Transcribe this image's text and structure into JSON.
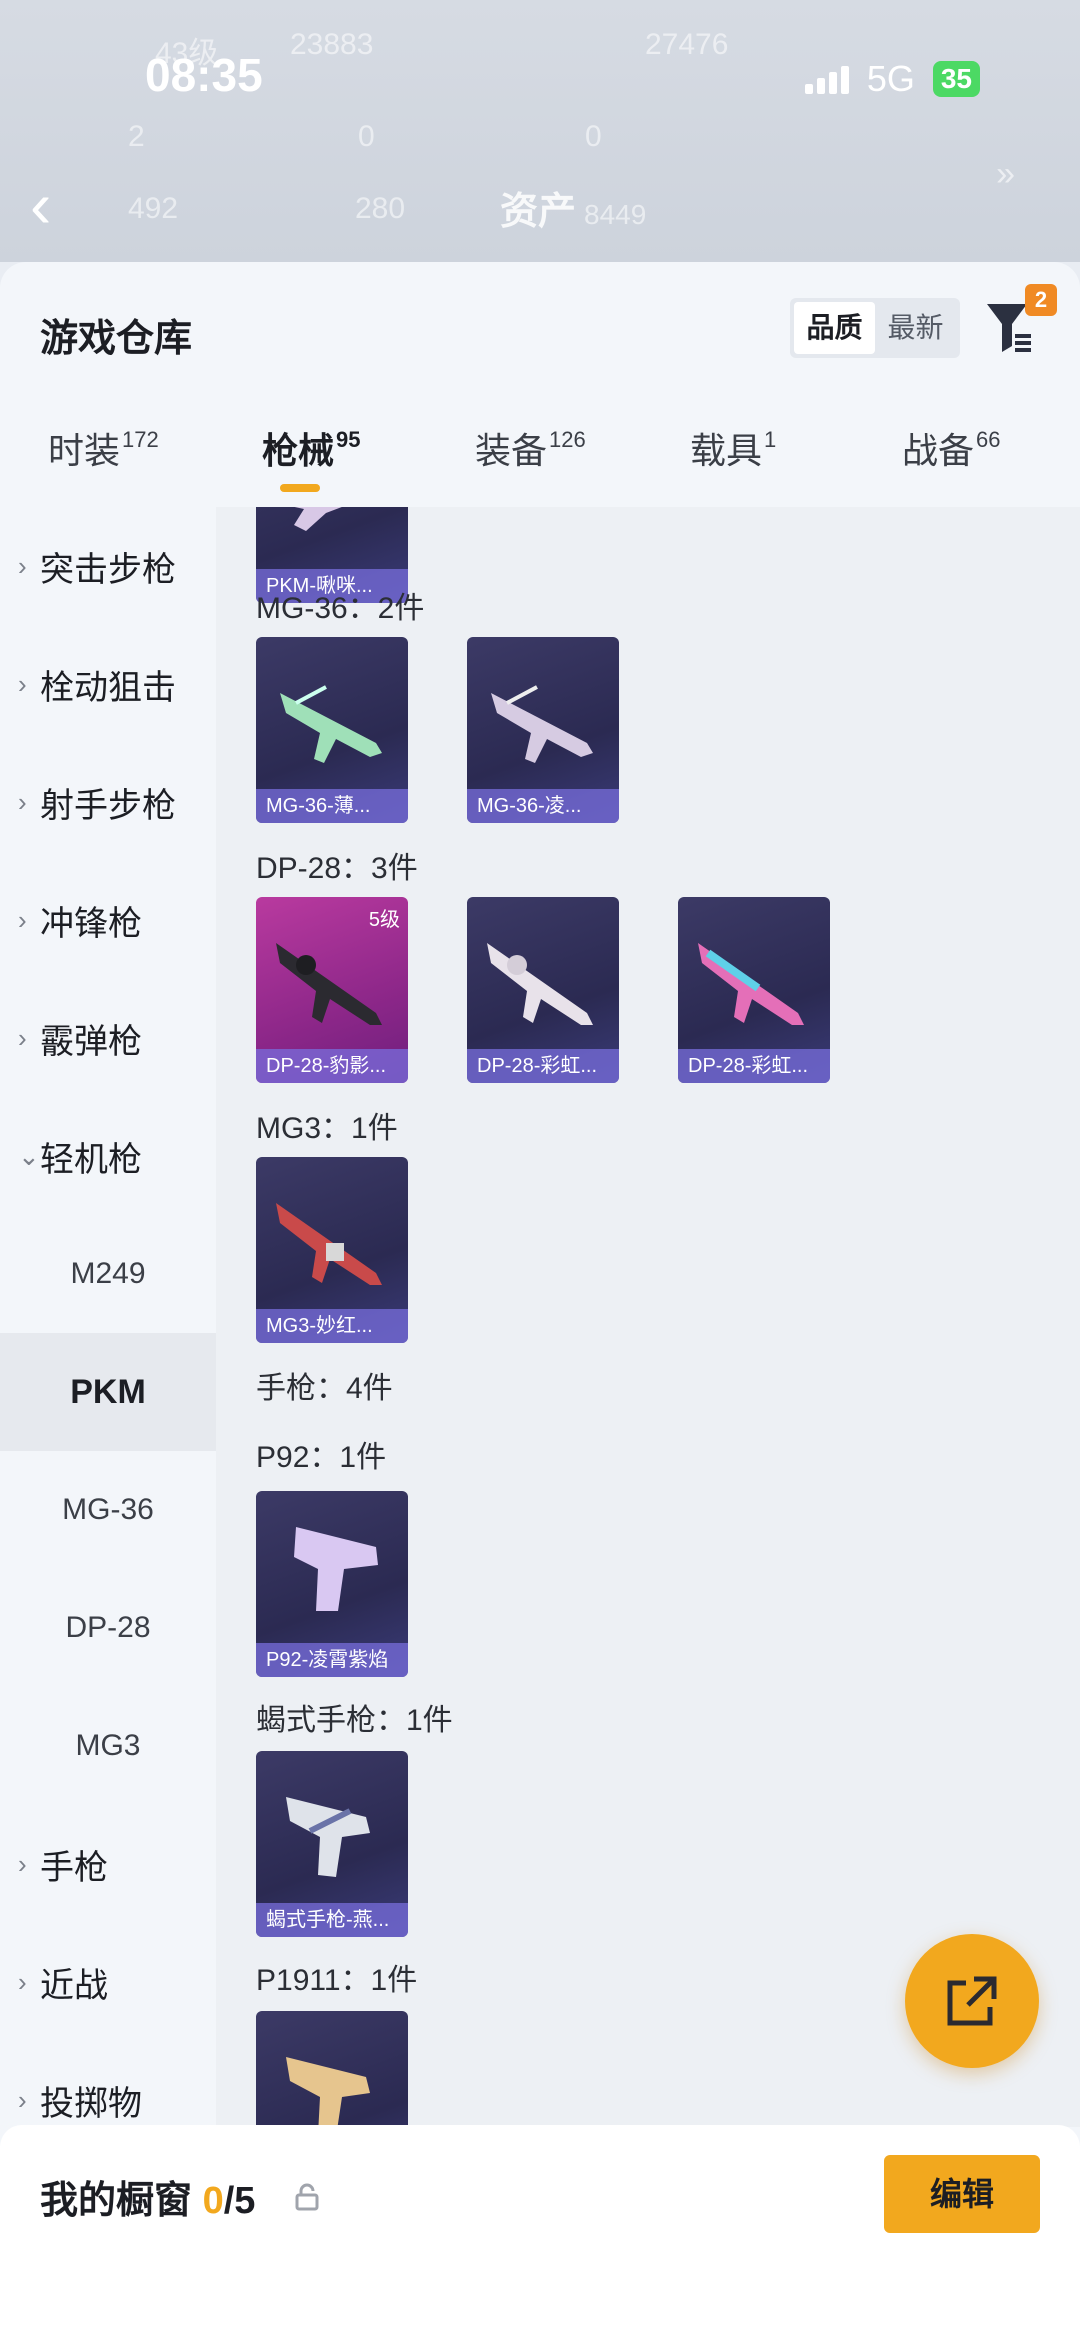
{
  "status": {
    "time": "08:35",
    "network": "5G",
    "battery": "35"
  },
  "bg": {
    "level": "43级",
    "score": "23883",
    "points": "27476",
    "n1": "2",
    "n2": "0",
    "n3": "0",
    "n4": "492",
    "n5": "280",
    "asset_label": "资产",
    "asset_value": "8449"
  },
  "sheet": {
    "title": "游戏仓库",
    "sort_options": [
      "品质",
      "最新"
    ],
    "filter_badge": "2"
  },
  "tabs": [
    {
      "label": "时装",
      "count": "172"
    },
    {
      "label": "枪械",
      "count": "95"
    },
    {
      "label": "装备",
      "count": "126"
    },
    {
      "label": "载具",
      "count": "1"
    },
    {
      "label": "战备",
      "count": "66"
    }
  ],
  "sidebar": {
    "categories": [
      "突击步枪",
      "栓动狙击",
      "射手步枪",
      "冲锋枪",
      "霰弹枪",
      "轻机枪"
    ],
    "subs": [
      "M249",
      "PKM",
      "MG-36",
      "DP-28",
      "MG3"
    ],
    "after": [
      "手枪",
      "近战",
      "投掷物"
    ]
  },
  "content": {
    "top_card": "PKM-啾咪...",
    "groups": [
      {
        "label": "MG-36：2件",
        "items": [
          "MG-36-薄...",
          "MG-36-凌..."
        ]
      },
      {
        "label": "DP-28：3件",
        "items": [
          "DP-28-豹影...",
          "DP-28-彩虹...",
          "DP-28-彩虹..."
        ],
        "level": "5级"
      },
      {
        "label": "MG3：1件",
        "items": [
          "MG3-妙红..."
        ]
      },
      {
        "label": "手枪：4件"
      },
      {
        "label": "P92：1件",
        "items": [
          "P92-凌霄紫焰"
        ]
      },
      {
        "label": "蝎式手枪：1件",
        "items": [
          "蝎式手枪-燕..."
        ]
      },
      {
        "label": "P1911：1件"
      }
    ]
  },
  "bottom": {
    "title": "我的橱窗",
    "current": "0",
    "total": "/5",
    "edit": "编辑"
  },
  "colors": {
    "accent": "#f2a81e",
    "card_purple": "#3c3a66",
    "card_pink": "#b93a9f"
  }
}
